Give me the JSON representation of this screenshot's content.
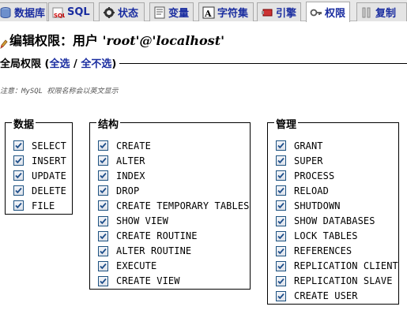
{
  "tabs": [
    {
      "label": "数据库",
      "icon": "database-icon",
      "active": false
    },
    {
      "label": "SQL",
      "icon": "sql-icon",
      "active": false
    },
    {
      "label": "状态",
      "icon": "status-icon",
      "active": false
    },
    {
      "label": "变量",
      "icon": "variables-icon",
      "active": false
    },
    {
      "label": "字符集",
      "icon": "charset-icon",
      "active": false
    },
    {
      "label": "引擎",
      "icon": "engine-icon",
      "active": false
    },
    {
      "label": "权限",
      "icon": "privileges-icon",
      "active": true
    },
    {
      "label": "复制",
      "icon": "replication-icon",
      "active": false
    }
  ],
  "header": {
    "prefix": "编辑权限：用户 ",
    "user": "'root'@'localhost'"
  },
  "global": {
    "title": "全局权限",
    "open_paren": " (",
    "select_all": "全选",
    "separator": " / ",
    "deselect_all": "全不选",
    "close_paren": ")"
  },
  "note": "注意：MySQL 权限名称会以英文显示",
  "groups": {
    "data": {
      "legend": "数据",
      "items": [
        "SELECT",
        "INSERT",
        "UPDATE",
        "DELETE",
        "FILE"
      ]
    },
    "structure": {
      "legend": "结构",
      "items": [
        "CREATE",
        "ALTER",
        "INDEX",
        "DROP",
        "CREATE TEMPORARY TABLES",
        "SHOW VIEW",
        "CREATE ROUTINE",
        "ALTER ROUTINE",
        "EXECUTE",
        "CREATE VIEW"
      ]
    },
    "admin": {
      "legend": "管理",
      "items": [
        "GRANT",
        "SUPER",
        "PROCESS",
        "RELOAD",
        "SHUTDOWN",
        "SHOW DATABASES",
        "LOCK TABLES",
        "REFERENCES",
        "REPLICATION CLIENT",
        "REPLICATION SLAVE",
        "CREATE USER"
      ]
    }
  },
  "colors": {
    "tab_text": "#1a2da0",
    "checkbox_border": "#1c5180",
    "check_mark": "#1f4f8a"
  }
}
